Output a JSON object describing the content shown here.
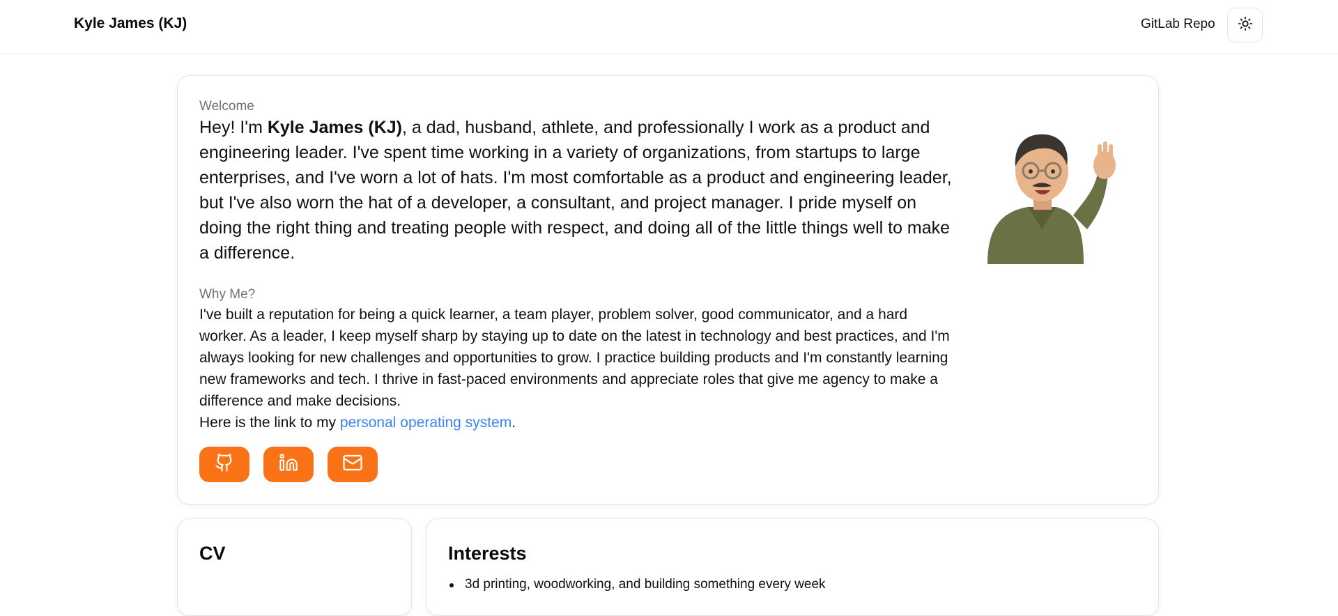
{
  "header": {
    "brand": "Kyle James (KJ)",
    "repo_link": "GitLab Repo",
    "theme_toggle_icon": "sun-icon"
  },
  "hero": {
    "welcome_label": "Welcome",
    "intro_prefix": "Hey! I'm ",
    "intro_name": "Kyle James (KJ)",
    "intro_rest": ", a dad, husband, athlete, and professionally I work as a product and engineering leader. I've spent time working in a variety of organizations, from startups to large enterprises, and I've worn a lot of hats. I'm most comfortable as a product and engineering leader, but I've also worn the hat of a developer, a consultant, and project manager. I pride myself on doing the right thing and treating people with respect, and doing all of the little things well to make a difference.",
    "why_label": "Why Me?",
    "why_text": "I've built a reputation for being a quick learner, a team player, problem solver, good communicator, and a hard worker. As a leader, I keep myself sharp by staying up to date on the latest in technology and best practices, and I'm always looking for new challenges and opportunities to grow. I practice building products and I'm constantly learning new frameworks and tech. I thrive in fast-paced environments and appreciate roles that give me agency to make a difference and make decisions.",
    "link_prefix": "Here is the link to my ",
    "link_text": "personal operating system",
    "link_suffix": ".",
    "social_icons": [
      "github-icon",
      "linkedin-icon",
      "mail-icon"
    ],
    "accent_color": "#f97316",
    "link_color": "#3b82f6"
  },
  "cv": {
    "title": "CV"
  },
  "interests": {
    "title": "Interests",
    "items": [
      "3d printing, woodworking, and building something every week"
    ]
  }
}
